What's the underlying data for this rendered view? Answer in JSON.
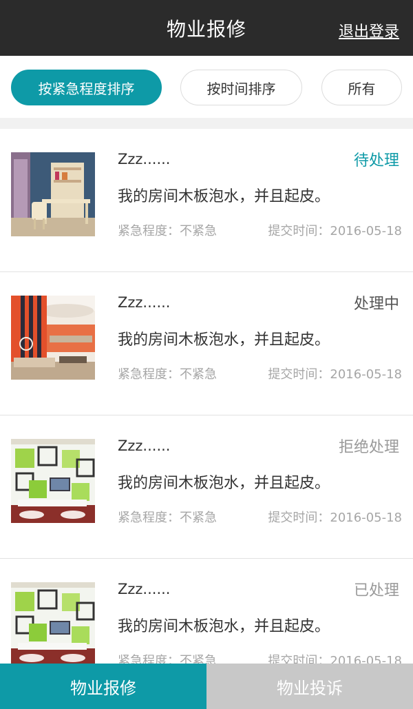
{
  "header": {
    "title": "物业报修",
    "logout_label": "退出登录"
  },
  "filters": {
    "by_urgency": "按紧急程度排序",
    "by_time": "按时间排序",
    "all": "所有"
  },
  "colors": {
    "accent": "#0e9aa7",
    "header_bg": "#2b2b2b",
    "status_pending": "#0e9aa7",
    "status_processing": "#555555",
    "status_rejected": "#9a9a9a",
    "status_done": "#9a9a9a"
  },
  "items": [
    {
      "name": "Zzz......",
      "status": "待处理",
      "description": "我的房间木板泡水，并且起皮。",
      "urgency": "紧急程度：不紧急",
      "time": "提交时间：2016-05-18",
      "image": "room-photo-study"
    },
    {
      "name": "Zzz......",
      "status": "处理中",
      "description": "我的房间木板泡水，并且起皮。",
      "urgency": "紧急程度：不紧急",
      "time": "提交时间：2016-05-18",
      "image": "room-photo-living-orange"
    },
    {
      "name": "Zzz......",
      "status": "拒绝处理",
      "description": "我的房间木板泡水，并且起皮。",
      "urgency": "紧急程度：不紧急",
      "time": "提交时间：2016-05-18",
      "image": "room-photo-tv-wall"
    },
    {
      "name": "Zzz......",
      "status": "已处理",
      "description": "我的房间木板泡水，并且起皮。",
      "urgency": "紧急程度：不紧急",
      "time": "提交时间：2016-05-18",
      "image": "room-photo-tv-wall"
    }
  ],
  "bottom_nav": {
    "repair": "物业报修",
    "complaint": "物业投诉"
  }
}
